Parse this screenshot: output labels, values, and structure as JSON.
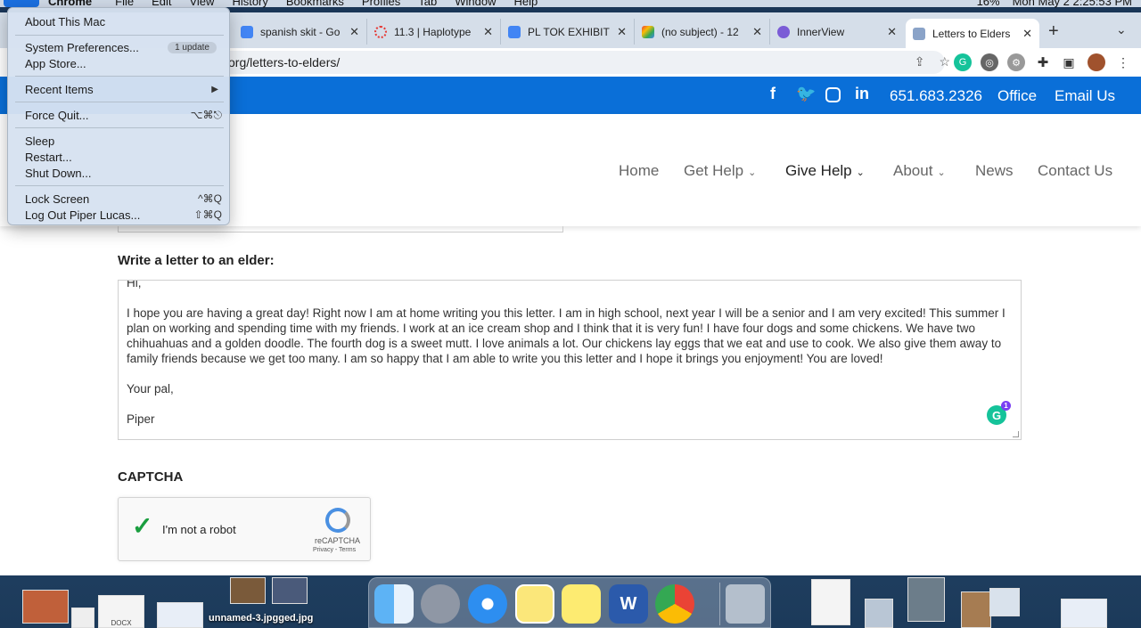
{
  "menubar": {
    "app": "Chrome",
    "items": [
      "File",
      "Edit",
      "View",
      "History",
      "Bookmarks",
      "Profiles",
      "Tab",
      "Window",
      "Help"
    ],
    "battery": "16%",
    "clock": "Mon May 2  2:25:53 PM"
  },
  "apple_menu": {
    "about": "About This Mac",
    "sysprefs": "System Preferences...",
    "update_badge": "1 update",
    "appstore": "App Store...",
    "recent": "Recent Items",
    "forcequit": "Force Quit...",
    "forcequit_sc": "⌥⌘⎋",
    "sleep": "Sleep",
    "restart": "Restart...",
    "shutdown": "Shut Down...",
    "lock": "Lock Screen",
    "lock_sc": "^⌘Q",
    "logout": "Log Out Piper Lucas...",
    "logout_sc": "⇧⌘Q"
  },
  "tabs": [
    {
      "title": "spanish skit - Go",
      "fav": "#4285f4"
    },
    {
      "title": "11.3 | Haplotype",
      "fav": "#e53935"
    },
    {
      "title": "PL TOK EXHIBITI",
      "fav": "#4285f4"
    },
    {
      "title": "(no subject) - 12",
      "fav": "#ea4335"
    },
    {
      "title": "InnerView",
      "fav": "#7b5cd6"
    },
    {
      "title": "Letters to Elders",
      "fav": "#8aa3c8"
    }
  ],
  "omnibox": {
    "url_visible": "org/letters-to-elders/"
  },
  "site": {
    "phone": "651.683.2326",
    "office": "Office",
    "email": "Email Us",
    "nav": {
      "home": "Home",
      "get_help": "Get Help",
      "give_help": "Give Help",
      "about": "About",
      "news": "News",
      "contact": "Contact Us"
    },
    "letter_label": "Write a letter to an elder:",
    "letter": {
      "greeting": "Hi,",
      "body": "I hope you are having a great day! Right now I am at home writing you this letter. I am in high school, next year I will be a senior and I am very excited! This summer I plan on working and spending time with my friends. I work at an ice cream shop and I think that it is very fun! I have four dogs and some chickens. We have two chihuahuas and a golden doodle. The fourth dog is a sweet mutt. I love animals a lot. Our chickens lay eggs that we eat and use to cook. We also give them away to family friends because we get too many. I am so happy that I am able to write you this letter and I hope it brings you enjoyment! You are loved!",
      "signoff": "Your pal,",
      "name": "Piper"
    },
    "grammarly_count": "1",
    "captcha_label": "CAPTCHA",
    "captcha": {
      "text": "I'm not a robot",
      "brand": "reCAPTCHA",
      "links": "Privacy - Terms"
    }
  },
  "desktop": {
    "file_label": "unnamed-3.jpgged.jpg",
    "docx_label": "DOCX"
  }
}
